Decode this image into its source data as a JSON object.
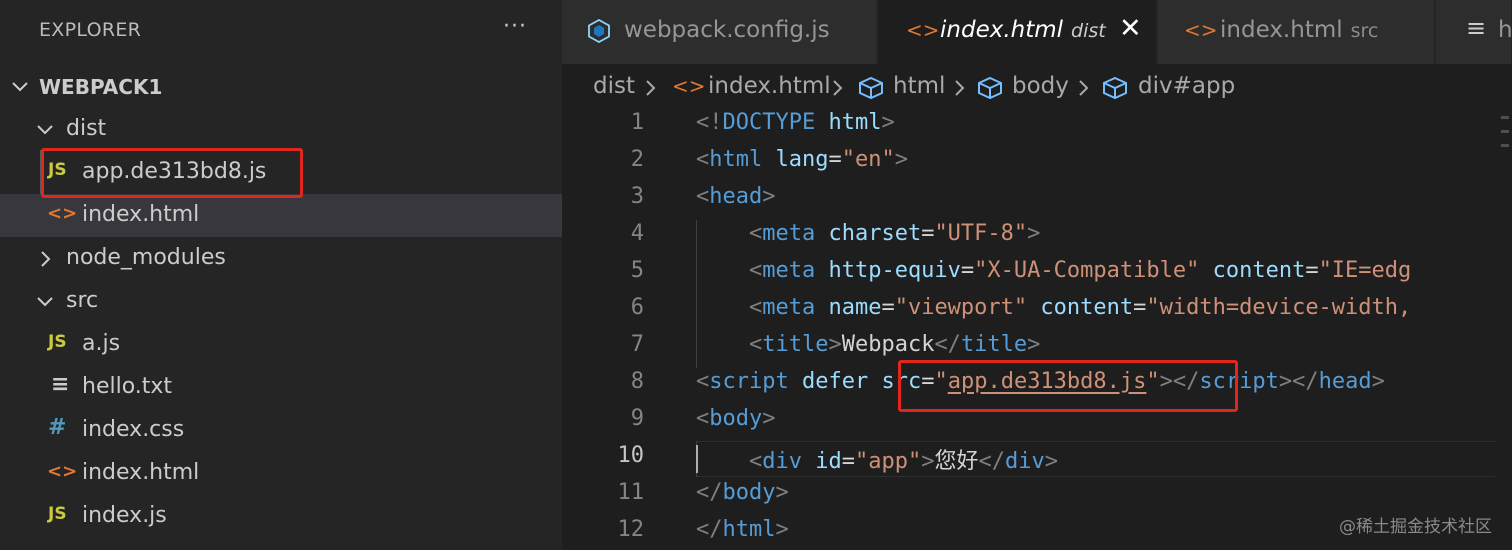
{
  "sidebar": {
    "title": "EXPLORER",
    "more": "···",
    "root": "WEBPACK1",
    "items": [
      {
        "label": "dist",
        "icon": "chevron-down-icon"
      },
      {
        "label": "app.de313bd8.js",
        "icon": "js-file-icon",
        "glyph": "JS"
      },
      {
        "label": "index.html",
        "icon": "html-file-icon",
        "glyph": "<>"
      },
      {
        "label": "node_modules",
        "icon": "chevron-right-icon"
      },
      {
        "label": "src",
        "icon": "chevron-down-icon"
      },
      {
        "label": "a.js",
        "icon": "js-file-icon",
        "glyph": "JS"
      },
      {
        "label": "hello.txt",
        "icon": "text-file-icon",
        "glyph": "≡"
      },
      {
        "label": "index.css",
        "icon": "css-file-icon",
        "glyph": "#"
      },
      {
        "label": "index.html",
        "icon": "html-file-icon",
        "glyph": "<>"
      },
      {
        "label": "index.js",
        "icon": "js-file-icon",
        "glyph": "JS"
      }
    ]
  },
  "tabs": [
    {
      "label": "webpack.config.js",
      "desc": "",
      "icon": "webpack-icon",
      "active": false
    },
    {
      "label": "index.html",
      "desc": "dist",
      "icon": "html-file-icon",
      "glyph": "<>",
      "active": true,
      "close": "✕"
    },
    {
      "label": "index.html",
      "desc": "src",
      "icon": "html-file-icon",
      "glyph": "<>",
      "active": false
    },
    {
      "label": "he",
      "desc": "",
      "icon": "text-file-icon",
      "glyph": "≡",
      "active": false
    }
  ],
  "breadcrumb": {
    "items": [
      "dist",
      "index.html",
      "html",
      "body",
      "div#app"
    ],
    "separator": ">"
  },
  "editor": {
    "current_line": 10,
    "lines": [
      {
        "n": "1",
        "tokens": [
          [
            "p",
            "<!"
          ],
          [
            "tag",
            "DOCTYPE"
          ],
          [
            "t",
            " "
          ],
          [
            "attr",
            "html"
          ],
          [
            "p",
            ">"
          ]
        ]
      },
      {
        "n": "2",
        "tokens": [
          [
            "p",
            "<"
          ],
          [
            "tag",
            "html"
          ],
          [
            "t",
            " "
          ],
          [
            "attr",
            "lang"
          ],
          [
            "t",
            "="
          ],
          [
            "str",
            "\"en\""
          ],
          [
            "p",
            ">"
          ]
        ]
      },
      {
        "n": "3",
        "tokens": [
          [
            "p",
            "<"
          ],
          [
            "tag",
            "head"
          ],
          [
            "p",
            ">"
          ]
        ]
      },
      {
        "n": "4",
        "tokens": [
          [
            "t",
            "    "
          ],
          [
            "p",
            "<"
          ],
          [
            "tag",
            "meta"
          ],
          [
            "t",
            " "
          ],
          [
            "attr",
            "charset"
          ],
          [
            "t",
            "="
          ],
          [
            "str",
            "\"UTF-8\""
          ],
          [
            "p",
            ">"
          ]
        ]
      },
      {
        "n": "5",
        "tokens": [
          [
            "t",
            "    "
          ],
          [
            "p",
            "<"
          ],
          [
            "tag",
            "meta"
          ],
          [
            "t",
            " "
          ],
          [
            "attr",
            "http-equiv"
          ],
          [
            "t",
            "="
          ],
          [
            "str",
            "\"X-UA-Compatible\""
          ],
          [
            "t",
            " "
          ],
          [
            "attr",
            "content"
          ],
          [
            "t",
            "="
          ],
          [
            "str",
            "\"IE=edg"
          ]
        ]
      },
      {
        "n": "6",
        "tokens": [
          [
            "t",
            "    "
          ],
          [
            "p",
            "<"
          ],
          [
            "tag",
            "meta"
          ],
          [
            "t",
            " "
          ],
          [
            "attr",
            "name"
          ],
          [
            "t",
            "="
          ],
          [
            "str",
            "\"viewport\""
          ],
          [
            "t",
            " "
          ],
          [
            "attr",
            "content"
          ],
          [
            "t",
            "="
          ],
          [
            "str",
            "\"width=device-width,"
          ]
        ]
      },
      {
        "n": "7",
        "tokens": [
          [
            "t",
            "    "
          ],
          [
            "p",
            "<"
          ],
          [
            "tag",
            "title"
          ],
          [
            "p",
            ">"
          ],
          [
            "t",
            "Webpack"
          ],
          [
            "p",
            "</"
          ],
          [
            "tag",
            "title"
          ],
          [
            "p",
            ">"
          ]
        ]
      },
      {
        "n": "8",
        "tokens": [
          [
            "p",
            "<"
          ],
          [
            "tag",
            "script"
          ],
          [
            "t",
            " "
          ],
          [
            "attr",
            "defer"
          ],
          [
            "t",
            " "
          ],
          [
            "attr",
            "src"
          ],
          [
            "t",
            "="
          ],
          [
            "str",
            "\""
          ],
          [
            "strU",
            "app.de313bd8.js"
          ],
          [
            "str",
            "\""
          ],
          [
            "p",
            "></"
          ],
          [
            "tag",
            "script"
          ],
          [
            "p",
            "></"
          ],
          [
            "tag",
            "head"
          ],
          [
            "p",
            ">"
          ]
        ]
      },
      {
        "n": "9",
        "tokens": [
          [
            "p",
            "<"
          ],
          [
            "tag",
            "body"
          ],
          [
            "p",
            ">"
          ]
        ]
      },
      {
        "n": "10",
        "tokens": [
          [
            "t",
            "    "
          ],
          [
            "p",
            "<"
          ],
          [
            "tag",
            "div"
          ],
          [
            "t",
            " "
          ],
          [
            "attr",
            "id"
          ],
          [
            "t",
            "="
          ],
          [
            "str",
            "\"app\""
          ],
          [
            "p",
            ">"
          ],
          [
            "t",
            "您好"
          ],
          [
            "p",
            "</"
          ],
          [
            "tag",
            "div"
          ],
          [
            "p",
            ">"
          ]
        ]
      },
      {
        "n": "11",
        "tokens": [
          [
            "p",
            "</"
          ],
          [
            "tag",
            "body"
          ],
          [
            "p",
            ">"
          ]
        ]
      },
      {
        "n": "12",
        "tokens": [
          [
            "p",
            "</"
          ],
          [
            "tag",
            "html"
          ],
          [
            "p",
            ">"
          ]
        ]
      }
    ]
  },
  "watermark": "@稀土掘金技术社区",
  "colors": {
    "highlight_box": "#e0261d",
    "js_icon": "#cbcb41",
    "html_icon": "#e37933",
    "css_icon": "#519aba",
    "tag": "#569cd6",
    "attr": "#9cdcfe",
    "string": "#ce9178"
  }
}
